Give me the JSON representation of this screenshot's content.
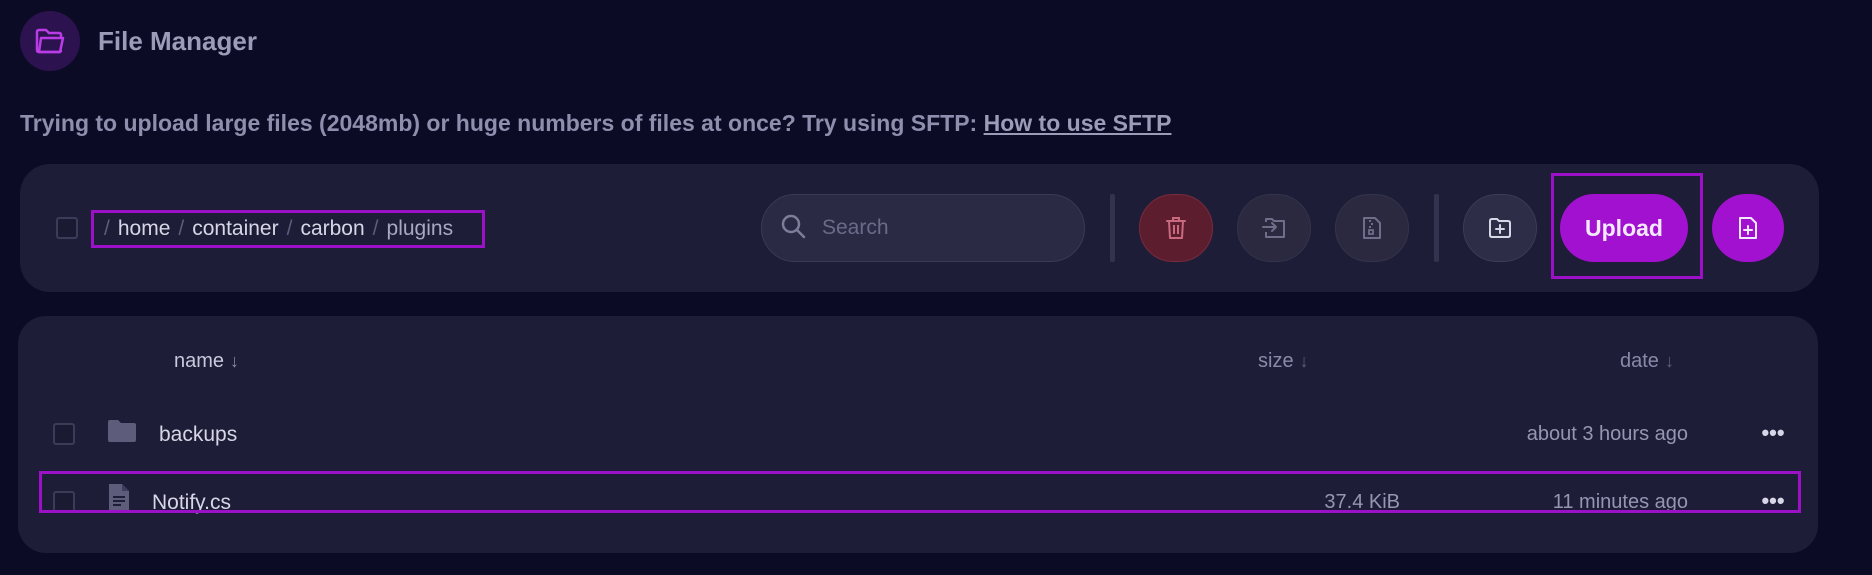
{
  "header": {
    "title": "File Manager",
    "icon": "folder-icon"
  },
  "notice": {
    "text": "Trying to upload large files (2048mb) or huge numbers of files at once? Try using SFTP:",
    "link_label": "How to use SFTP"
  },
  "toolbar": {
    "breadcrumb": {
      "separator": "/",
      "crumbs": [
        "home",
        "container",
        "carbon",
        "plugins"
      ]
    },
    "search": {
      "placeholder": "Search"
    },
    "upload_label": "Upload"
  },
  "table": {
    "columns": {
      "name": "name",
      "size": "size",
      "date": "date",
      "sort_arrow": "↓"
    },
    "rows": [
      {
        "name": "backups",
        "size": "",
        "date": "about 3 hours ago",
        "type": "folder"
      },
      {
        "name": "Notify.cs",
        "size": "37.4 KiB",
        "date": "11 minutes ago",
        "type": "file"
      }
    ],
    "more_label": "•••"
  },
  "colors": {
    "background": "#0c0b26",
    "panel": "#1e1d38",
    "accent": "#a211cf",
    "danger": "#5c1d2e"
  }
}
